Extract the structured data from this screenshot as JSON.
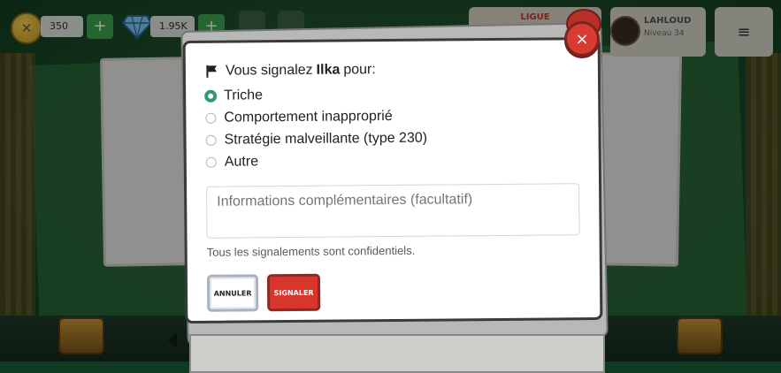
{
  "hud": {
    "coins": "350",
    "gems": "1.95K",
    "league_label": "LIGUE",
    "player_name": "LAHLOUD",
    "player_level": "Niveau 34",
    "plus_label": "+",
    "menu_glyph": "≡"
  },
  "modal": {
    "title_prefix": "Vous signalez",
    "reported_user": "Ilka",
    "title_suffix": "pour:",
    "options": [
      {
        "label": "Triche",
        "selected": true
      },
      {
        "label": "Comportement inapproprié",
        "selected": false
      },
      {
        "label": "Stratégie malveillante (type 230)",
        "selected": false
      },
      {
        "label": "Autre",
        "selected": false
      }
    ],
    "notes_placeholder": "Informations complémentaires (facultatif)",
    "confidential_note": "Tous les signalements sont confidentiels.",
    "cancel_label": "ANNULER",
    "report_label": "SIGNALER",
    "close_glyph": "×"
  },
  "colors": {
    "accent_green": "#2e9b6f",
    "danger_red": "#d8362c"
  },
  "icons": [
    "coin-icon",
    "gem-icon",
    "flag-icon",
    "close-icon",
    "menu-icon",
    "chest-icon"
  ]
}
